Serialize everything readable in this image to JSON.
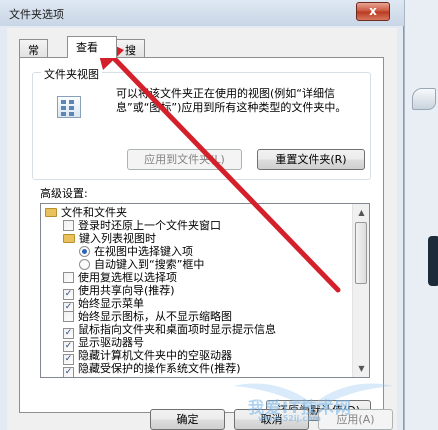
{
  "window": {
    "title": "文件夹选项",
    "close_glyph": "x"
  },
  "tabs": [
    {
      "label": "常规"
    },
    {
      "label": "查看"
    },
    {
      "label": "搜索"
    }
  ],
  "folder_views": {
    "legend": "文件夹视图",
    "description": "可以将该文件夹正在使用的视图(例如“详细信息”或“图标”)应用到所有这种类型的文件夹中。",
    "apply_button": "应用到文件夹(L)",
    "reset_button": "重置文件夹(R)"
  },
  "advanced": {
    "label": "高级设置:",
    "items": [
      {
        "type": "folder",
        "text": "文件和文件夹"
      },
      {
        "type": "check",
        "checked": false,
        "text": "登录时还原上一个文件夹窗口"
      },
      {
        "type": "folder",
        "text": "键入列表视图时"
      },
      {
        "type": "radio",
        "checked": true,
        "text": "在视图中选择键入项"
      },
      {
        "type": "radio",
        "checked": false,
        "text": "自动键入到“搜索”框中"
      },
      {
        "type": "check",
        "checked": false,
        "text": "使用复选框以选择项"
      },
      {
        "type": "check",
        "checked": true,
        "text": "使用共享向导(推荐)"
      },
      {
        "type": "check",
        "checked": true,
        "text": "始终显示菜单"
      },
      {
        "type": "check",
        "checked": false,
        "text": "始终显示图标，从不显示缩略图"
      },
      {
        "type": "check",
        "checked": true,
        "text": "鼠标指向文件夹和桌面项时显示提示信息"
      },
      {
        "type": "check",
        "checked": true,
        "text": "显示驱动器号"
      },
      {
        "type": "check",
        "checked": true,
        "text": "隐藏计算机文件夹中的空驱动器"
      },
      {
        "type": "check",
        "checked": true,
        "text": "隐藏受保护的操作系统文件(推荐)"
      }
    ],
    "restore_defaults_button": "还原为默认值(D)"
  },
  "footer": {
    "ok_button": "确定",
    "cancel_button": "取消",
    "apply_button": "应用(A)"
  },
  "watermark": {
    "title": "我爱IT技术网",
    "url": "www.52ij.com"
  },
  "colors": {
    "annotation_arrow": "#d4202a",
    "close_button": "#c9523b",
    "tab_border": "#8e8f8f"
  }
}
